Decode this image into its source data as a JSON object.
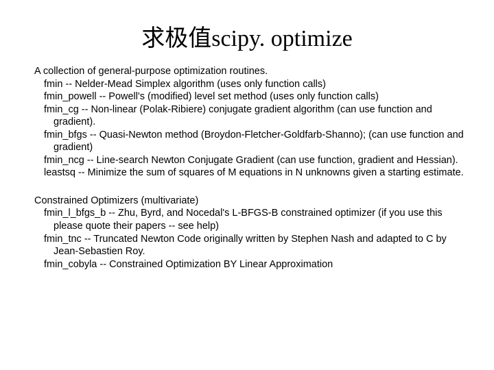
{
  "title": "求极值scipy. optimize",
  "section1": {
    "heading": "A collection of general-purpose optimization routines.",
    "items": [
      "fmin        --  Nelder-Mead Simplex algorithm  (uses only function calls)",
      "fmin_powell --  Powell's (modified) level set method (uses only function calls)",
      "fmin_cg     --  Non-linear (Polak-Ribiere) conjugate gradient algorithm  (can use function and gradient).",
      "fmin_bfgs   --  Quasi-Newton method (Broydon-Fletcher-Goldfarb-Shanno); (can use function and gradient)",
      "fmin_ncg    --  Line-search Newton Conjugate Gradient (can use function, gradient and Hessian).",
      "leastsq     --  Minimize the sum of squares of M equations in N unknowns given a starting estimate."
    ]
  },
  "section2": {
    "heading": "Constrained Optimizers (multivariate)",
    "items": [
      "fmin_l_bfgs_b -- Zhu, Byrd, and Nocedal's L-BFGS-B constrained optimizer (if you use this please quote their papers -- see help)",
      "fmin_tnc      -- Truncated Newton Code originally written by Stephen Nash and adapted to C by Jean-Sebastien Roy.",
      "fmin_cobyla   -- Constrained Optimization BY Linear Approximation"
    ]
  }
}
